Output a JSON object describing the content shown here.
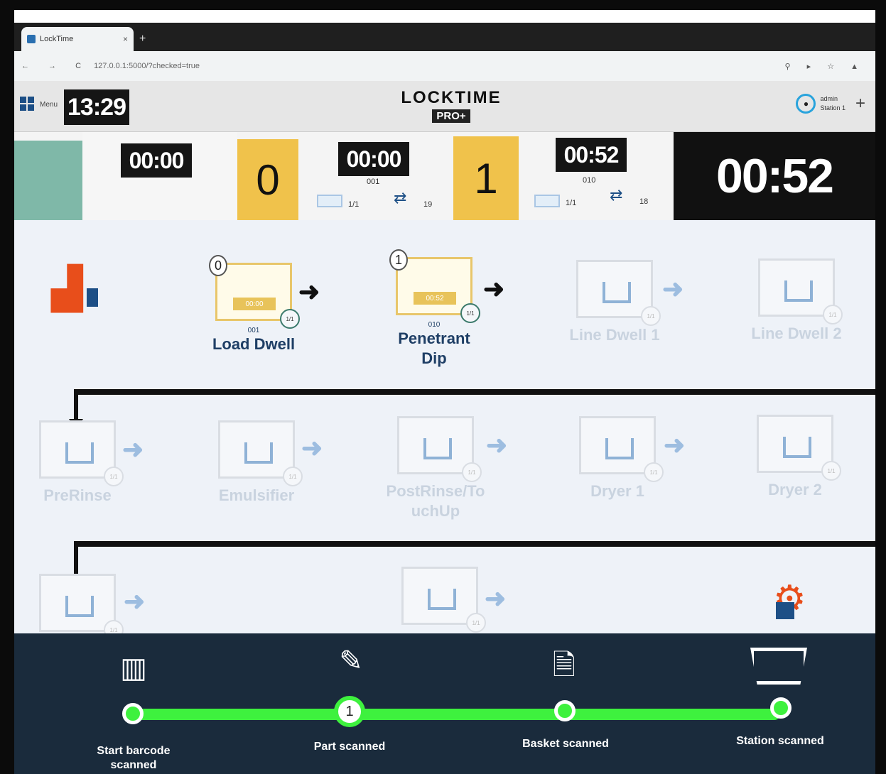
{
  "browser": {
    "tab_title": "LockTime",
    "tab_close": "×",
    "new_tab": "+",
    "nav_buttons": "← → C",
    "url": "127.0.0.1:5000/?checked=true",
    "toolbar_icons": "⚲ ▸ ☆ ▲"
  },
  "header": {
    "menu_label": "Menu",
    "clock": "13:29",
    "logo_text": "LOCKTIME",
    "logo_badge": "PRO+",
    "user_name": "admin",
    "user_station": "Station 1",
    "add_button": "+"
  },
  "status": {
    "slot1": {
      "time": "00:00"
    },
    "slot2": {
      "count": "0",
      "time": "00:00",
      "code": "001",
      "basket": "1/1",
      "route_count": "19"
    },
    "slot3": {
      "count": "1",
      "time": "00:52",
      "code": "010",
      "basket": "1/1",
      "route_count": "18"
    },
    "total_time": "00:52"
  },
  "stations": {
    "load_dwell": {
      "label": "Load Dwell",
      "count": "0",
      "time": "00:00",
      "code": "001",
      "badge": "1/1"
    },
    "penetrant_dip": {
      "label": "Penetrant Dip",
      "count": "1",
      "time": "00:52",
      "code": "010",
      "badge": "1/1"
    },
    "line_dwell_1": {
      "label": "Line Dwell 1"
    },
    "line_dwell_2": {
      "label": "Line Dwell 2"
    },
    "prerinse": {
      "label": "PreRinse"
    },
    "emulsifier": {
      "label": "Emulsifier"
    },
    "postrinse": {
      "label": "PostRinse/TouchUp"
    },
    "dryer_1": {
      "label": "Dryer 1"
    },
    "dryer_2": {
      "label": "Dryer 2"
    }
  },
  "progress": {
    "steps": [
      {
        "label": "Start barcode scanned",
        "icon": "barcode-icon"
      },
      {
        "label": "Part scanned",
        "icon": "part-icon",
        "count": "1"
      },
      {
        "label": "Basket scanned",
        "icon": "document-icon"
      },
      {
        "label": "Station scanned",
        "icon": "station-icon"
      }
    ]
  },
  "colors": {
    "accent": "#1d4f86",
    "highlight": "#f0c24b",
    "progress": "#3ef13e"
  }
}
